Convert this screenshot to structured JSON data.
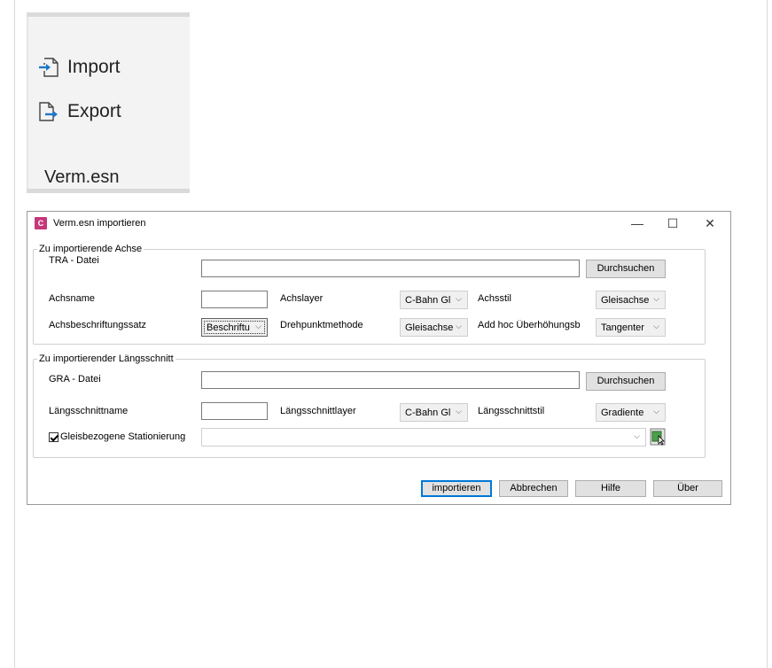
{
  "ribbon": {
    "import_label": "Import",
    "export_label": "Export",
    "panel_title": "Verm.esn"
  },
  "dialog": {
    "title": "Verm.esn importieren",
    "icon_letter": "C",
    "controls": {
      "minimize": "—",
      "maximize": "☐",
      "close": "✕"
    },
    "achse_group": {
      "legend": "Zu importierende Achse",
      "tra_label": "TRA - Datei",
      "tra_value": "",
      "browse_label": "Durchsuchen",
      "achsname_label": "Achsname",
      "achsname_value": "",
      "achslayer_label": "Achslayer",
      "achslayer_value": "C-Bahn Gl",
      "achsstil_label": "Achsstil",
      "achsstil_value": "Gleisachse",
      "beschriftung_label": "Achsbeschriftungssatz",
      "beschriftung_value": "Beschriftu",
      "drehpunkt_label": "Drehpunktmethode",
      "drehpunkt_value": "Gleisachse",
      "adhoc_label": "Add hoc Überhöhungsb",
      "adhoc_value": "Tangenter"
    },
    "laengsschnitt_group": {
      "legend": "Zu importierender Längsschnitt",
      "gra_label": "GRA - Datei",
      "gra_value": "",
      "browse_label": "Durchsuchen",
      "name_label": "Längsschnittname",
      "name_value": "",
      "layer_label": "Längsschnittlayer",
      "layer_value": "C-Bahn Gl",
      "stil_label": "Längsschnittstil",
      "stil_value": "Gradiente",
      "stationierung_label": "Gleisbezogene Stationierung",
      "stationierung_checked": true,
      "stationierung_value": ""
    },
    "buttons": {
      "import": "importieren",
      "cancel": "Abbrechen",
      "help": "Hilfe",
      "about": "Über"
    }
  }
}
